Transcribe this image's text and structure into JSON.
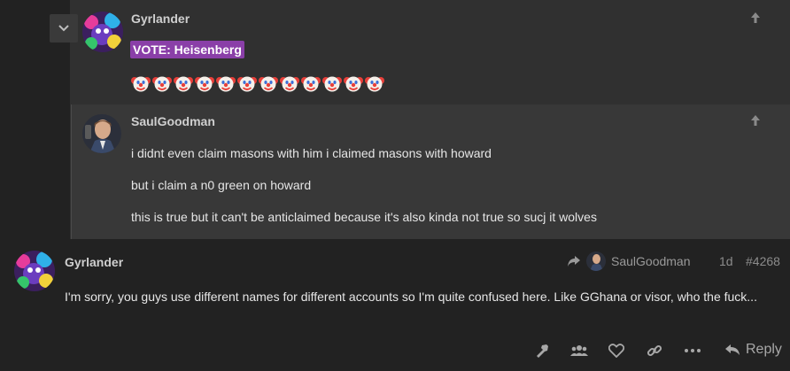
{
  "quote": {
    "author": "Gyrlander",
    "vote_text": "VOTE: Heisenberg",
    "clown_count": 12
  },
  "nested_quote": {
    "author": "SaulGoodman",
    "lines": [
      "i didnt even claim masons with him i claimed masons with howard",
      "but i claim a n0 green on howard",
      "this is true but it can't be anticlaimed because it's also kinda not true so sucj it wolves"
    ]
  },
  "post": {
    "author": "Gyrlander",
    "reply_to": "SaulGoodman",
    "age": "1d",
    "post_number": "#4268",
    "body": "I'm sorry, you guys use different names for different accounts so I'm quite confused here. Like GGhana or visor, who the fuck...",
    "reply_label": "Reply"
  },
  "icons": {
    "toggle": "chevron-down-icon",
    "jump_up": "arrow-up-icon",
    "reply_arrow": "share-arrow-icon",
    "actions": [
      "hammer-icon",
      "users-icon",
      "heart-icon",
      "link-icon",
      "ellipsis-icon",
      "reply-icon"
    ]
  },
  "colors": {
    "background": "#222222",
    "quote_bg": "#303030",
    "nested_bg": "#383838",
    "vote_bg": "#8a3fa8"
  }
}
